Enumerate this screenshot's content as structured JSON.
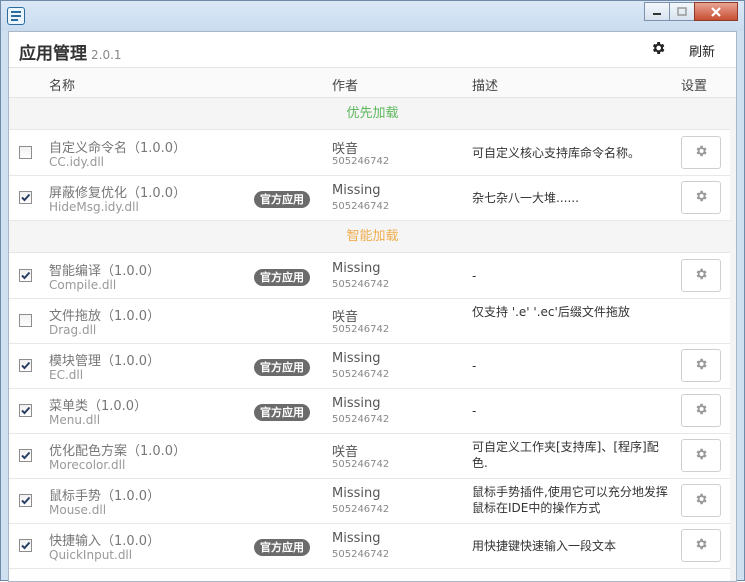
{
  "header": {
    "title": "应用管理",
    "version": "2.0.1",
    "refresh_label": "刷新"
  },
  "columns": {
    "name": "名称",
    "author": "作者",
    "desc": "描述",
    "settings": "设置"
  },
  "groups": [
    {
      "label": "优先加载",
      "color": "#5cb85c"
    },
    {
      "label": "智能加载",
      "color": "#f0ad4e"
    }
  ],
  "badge_label": "官方应用",
  "rows": [
    {
      "checked": false,
      "name": "自定义命令名（1.0.0）",
      "file": "CC.idy.dll",
      "badge": false,
      "author": "咲音",
      "author_id": "505246742",
      "desc": "可自定义核心支持库命令名称。",
      "settings": true
    },
    {
      "checked": true,
      "name": "屏蔽修复优化（1.0.0）",
      "file": "HideMsg.idy.dll",
      "badge": true,
      "author": "Missing",
      "author_id": "505246742",
      "desc": "杂七杂八一大堆......",
      "settings": true
    },
    {
      "checked": true,
      "name": "智能编译（1.0.0）",
      "file": "Compile.dll",
      "badge": true,
      "author": "Missing",
      "author_id": "505246742",
      "desc": "-",
      "settings": true
    },
    {
      "checked": false,
      "name": "文件拖放（1.0.0）",
      "file": "Drag.dll",
      "badge": false,
      "author": "咲音",
      "author_id": "505246742",
      "desc": "仅支持 '.e' '.ec'后缀文件拖放",
      "settings": false
    },
    {
      "checked": true,
      "name": "模块管理（1.0.0）",
      "file": "EC.dll",
      "badge": true,
      "author": "Missing",
      "author_id": "505246742",
      "desc": "-",
      "settings": true
    },
    {
      "checked": true,
      "name": "菜单类（1.0.0）",
      "file": "Menu.dll",
      "badge": true,
      "author": "Missing",
      "author_id": "505246742",
      "desc": "-",
      "settings": true
    },
    {
      "checked": true,
      "name": "优化配色方案（1.0.0）",
      "file": "Morecolor.dll",
      "badge": false,
      "author": "咲音",
      "author_id": "505246742",
      "desc": "可自定义工作夹[支持库]、[程序]配色.",
      "settings": true
    },
    {
      "checked": true,
      "name": "鼠标手势（1.0.0）",
      "file": "Mouse.dll",
      "badge": false,
      "author": "Missing",
      "author_id": "505246742",
      "desc": "鼠标手势插件,使用它可以充分地发挥鼠标在IDE中的操作方式",
      "settings": true
    },
    {
      "checked": true,
      "name": "快捷输入（1.0.0）",
      "file": "QuickInput.dll",
      "badge": true,
      "author": "Missing",
      "author_id": "505246742",
      "desc": "用快捷键快速输入一段文本",
      "settings": true
    }
  ]
}
